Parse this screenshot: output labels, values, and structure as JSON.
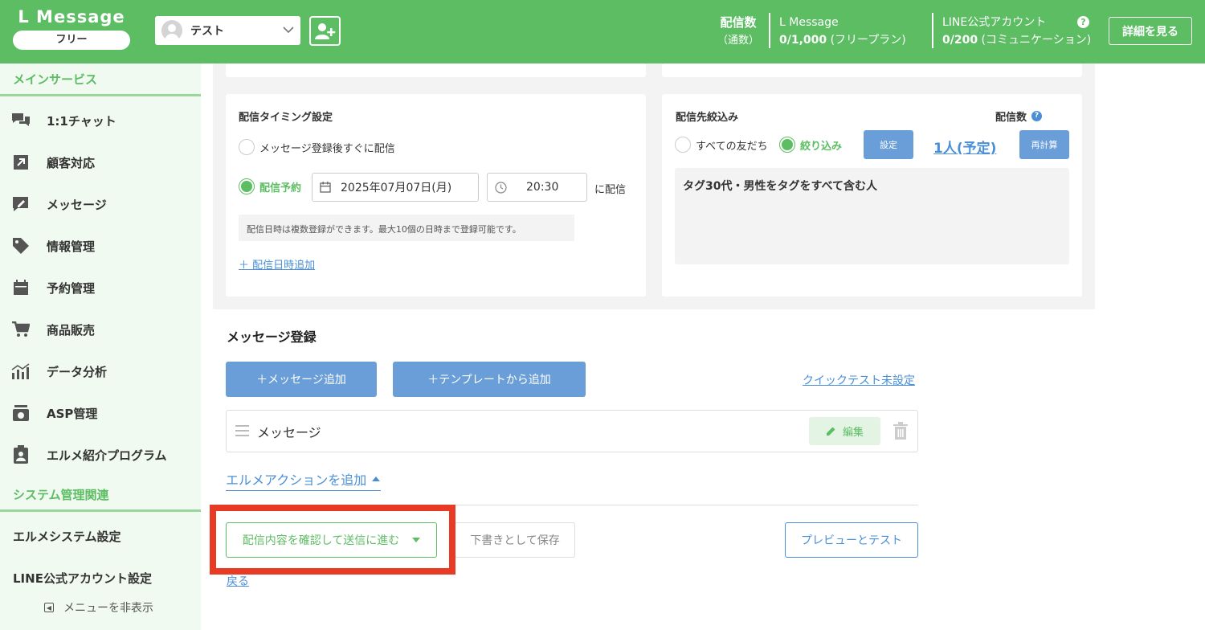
{
  "header": {
    "brand": "L Message",
    "plan": "フリー",
    "account_name": "テスト",
    "stats_label": "配信数",
    "stats_sublabel": "（通数）",
    "lmessage_label": "L Message",
    "lmessage_count": "0/1,000",
    "lmessage_plan": "(フリープラン)",
    "line_label": "LINE公式アカウント",
    "line_count": "0/200",
    "line_plan": "(コミュニケーション)",
    "help": "?",
    "details_button": "詳細を見る"
  },
  "sidebar": {
    "main_section": "メインサービス",
    "items": [
      {
        "label": "1:1チャット",
        "icon": "chat-icon"
      },
      {
        "label": "顧客対応",
        "icon": "arrow-icon"
      },
      {
        "label": "メッセージ",
        "icon": "edit-message-icon"
      },
      {
        "label": "情報管理",
        "icon": "tag-icon"
      },
      {
        "label": "予約管理",
        "icon": "calendar-icon"
      },
      {
        "label": "商品販売",
        "icon": "cart-icon"
      },
      {
        "label": "データ分析",
        "icon": "chart-icon"
      },
      {
        "label": "ASP管理",
        "icon": "register-icon"
      },
      {
        "label": "エルメ紹介プログラム",
        "icon": "clipboard-user-icon"
      }
    ],
    "system_section": "システム管理関連",
    "system_settings": "エルメシステム設定",
    "line_settings": "LINE公式アカウント設定",
    "hide_menu": "メニューを非表示"
  },
  "timing": {
    "title": "配信タイミング設定",
    "option_immediate": "メッセージ登録後すぐに配信",
    "option_schedule": "配信予約",
    "date": "2025年07月07日(月)",
    "time": "20:30",
    "suffix": "に配信",
    "note": "配信日時は複数登録ができます。最大10個の日時まで登録可能です。",
    "add_link": "＋ 配信日時追加"
  },
  "target": {
    "title": "配信先絞込み",
    "count_label": "配信数",
    "count_help": "?",
    "option_all": "すべての友だち",
    "option_filter": "絞り込み",
    "settings_button": "設定",
    "count_value": "1人(予定)",
    "recalc_button": "再計算",
    "condition_text": "タグ30代・男性をタグをすべて含む人"
  },
  "message_register": {
    "heading": "メッセージ登録",
    "add_message_button": "＋メッセージ追加",
    "add_template_button": "＋テンプレートから追加",
    "quick_test_link": "クイックテスト未設定",
    "message_label": "メッセージ",
    "edit_button": "編集",
    "action_link": "エルメアクションを追加",
    "confirm_button": "配信内容を確認して送信に進む",
    "draft_button": "下書きとして保存",
    "preview_button": "プレビューとテスト",
    "back_link": "戻る"
  },
  "colors": {
    "brand_green": "#5cbd63",
    "button_blue": "#6a9ed8",
    "highlight_red": "#e73b25"
  }
}
